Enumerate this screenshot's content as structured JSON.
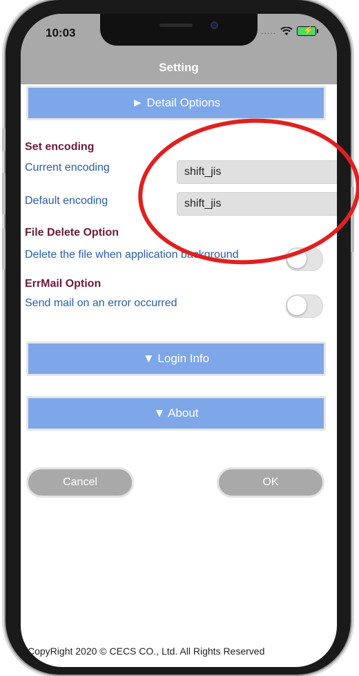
{
  "status_bar": {
    "time": "10:03",
    "signal": "....."
  },
  "nav": {
    "title": "Setting"
  },
  "sections": {
    "detail": "► Detail Options",
    "login": "▼ Login Info",
    "about": "▼ About"
  },
  "encoding": {
    "title": "Set encoding",
    "current_label": "Current encoding",
    "current_value": "shift_jis",
    "default_label": "Default encoding",
    "default_value": "shift_jis"
  },
  "file_delete": {
    "title": "File Delete Option",
    "description": "Delete the file when application background",
    "enabled": false
  },
  "errmail": {
    "title": "ErrMail Option",
    "description": "Send mail on an error occurred",
    "enabled": false
  },
  "buttons": {
    "cancel": "Cancel",
    "ok": "OK"
  },
  "footer": "CopyRight 2020 © CECS CO., Ltd. All Rights Reserved",
  "colors": {
    "section_blue": "#7da7e8",
    "nav_gray": "#a9a9a9",
    "group_title": "#6b1a3a",
    "label_blue": "#2a5aa8",
    "annotation_red": "#e02020"
  },
  "icons": [
    "wifi-icon",
    "battery-charging-icon",
    "camera-icon"
  ]
}
